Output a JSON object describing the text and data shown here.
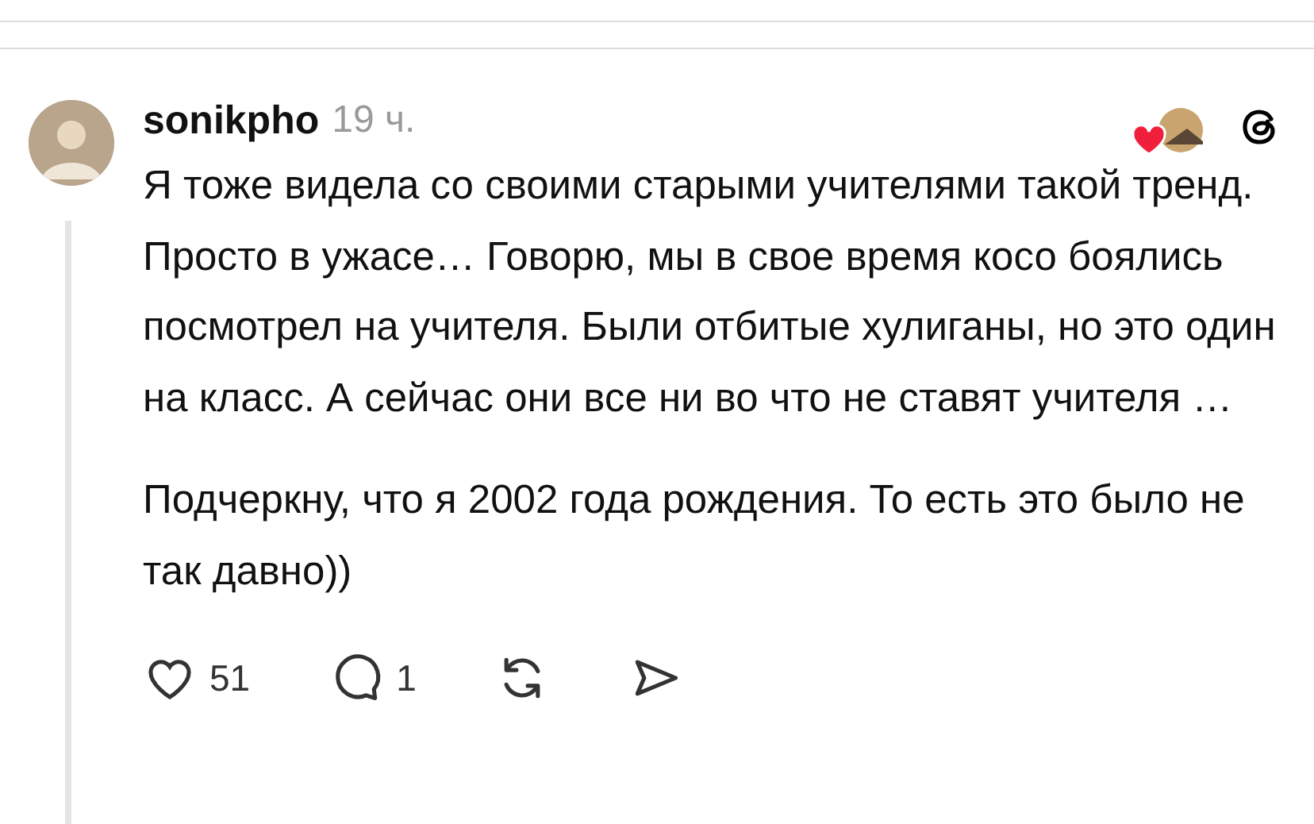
{
  "post": {
    "username": "sonikpho",
    "time": "19 ч.",
    "paragraphs": [
      "Я тоже видела со своими старыми учителями такой тренд. Просто в ужасе… Говорю, мы в свое время косо боялись посмотрел на учителя. Были отбитые хулиганы, но это один на класс. А сейчас они все ни во что не ставят учителя …",
      "Подчеркну, что я 2002 года рождения. То есть это было не так давно))"
    ],
    "liked_by_author": true,
    "actions": [
      {
        "kind": "like",
        "count": "51"
      },
      {
        "kind": "reply",
        "count": "1"
      },
      {
        "kind": "repost"
      },
      {
        "kind": "share"
      }
    ]
  }
}
